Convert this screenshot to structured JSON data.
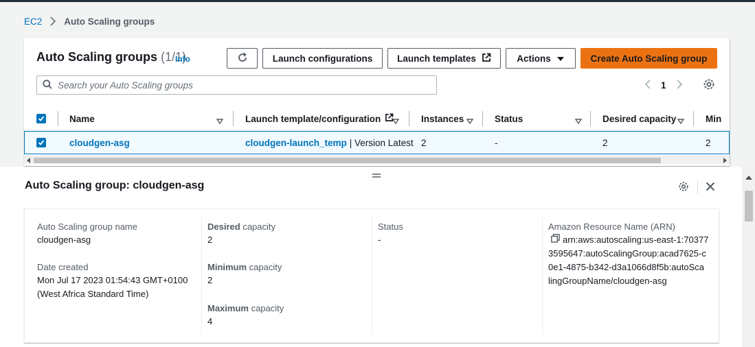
{
  "breadcrumb": {
    "root": "EC2",
    "current": "Auto Scaling groups"
  },
  "header": {
    "title": "Auto Scaling groups",
    "count": "(1/1)",
    "info": "Info",
    "launch_configurations": "Launch configurations",
    "launch_templates": "Launch templates",
    "actions": "Actions",
    "create": "Create Auto Scaling group"
  },
  "search": {
    "placeholder": "Search your Auto Scaling groups"
  },
  "pagination": {
    "page": "1"
  },
  "table": {
    "columns": [
      "Name",
      "Launch template/configuration",
      "Instances",
      "Status",
      "Desired capacity",
      "Min"
    ],
    "rows": [
      {
        "name": "cloudgen-asg",
        "template_link": "cloudgen-launch_temp",
        "template_suffix": "| Version Latest",
        "instances": "2",
        "status": "-",
        "desired": "2",
        "min": "2"
      }
    ]
  },
  "panel": {
    "title": "Auto Scaling group: cloudgen-asg",
    "group_name_label": "Auto Scaling group name",
    "group_name_value": "cloudgen-asg",
    "date_label": "Date created",
    "date_value_1": "Mon Jul 17 2023 01:54:43 GMT+0100",
    "date_value_2": "(West Africa Standard Time)",
    "desired_label_bold": "Desired",
    "desired_label_rest": " capacity",
    "desired_value": "2",
    "min_label_bold": "Minimum",
    "min_label_rest": " capacity",
    "min_value": "2",
    "max_label_bold": "Maximum",
    "max_label_rest": " capacity",
    "max_value": "4",
    "status_label": "Status",
    "status_value": "-",
    "arn_label": "Amazon Resource Name (ARN)",
    "arn_line_1": "arn:aws:autoscaling:us-east-1:70377",
    "arn_line_2": "3595647:autoScalingGroup:acad7625-c",
    "arn_line_3": "0e1-4875-b342-d3a1066d8f5b:autoSca",
    "arn_line_4": "lingGroupName/cloudgen-asg"
  },
  "colors": {
    "accent": "#0073bb",
    "primary_button": "#ec7211",
    "text": "#16191f"
  }
}
